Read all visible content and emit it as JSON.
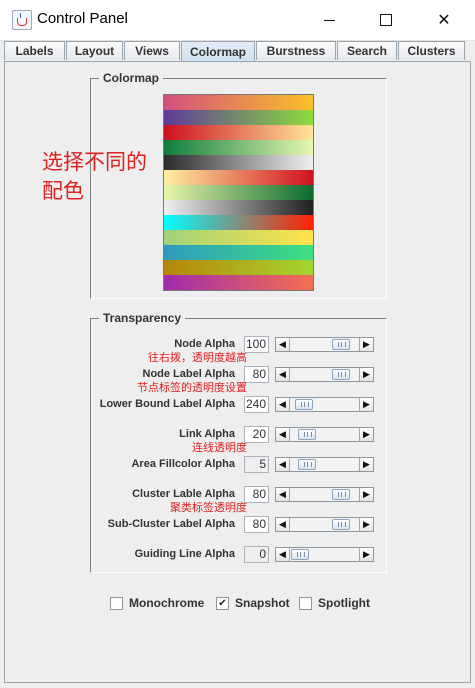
{
  "window": {
    "title": "Control Panel"
  },
  "tabs": [
    {
      "label": "Labels"
    },
    {
      "label": "Layout"
    },
    {
      "label": "Views"
    },
    {
      "label": "Colormap"
    },
    {
      "label": "Burstness"
    },
    {
      "label": "Search"
    },
    {
      "label": "Clusters"
    }
  ],
  "active_tab": "Colormap",
  "colormap": {
    "title": "Colormap",
    "note": "选择不同的配色",
    "swatches": [
      {
        "from": "#d2507e",
        "to": "#fbc02a"
      },
      {
        "from": "#5e3a9c",
        "to": "#8ddc3a"
      },
      {
        "from": "#cc1020",
        "to": "#ffe59a"
      },
      {
        "from": "#0e7d3e",
        "to": "#e6f7b0"
      },
      {
        "from": "#2b2b2b",
        "to": "#f0f0f0"
      },
      {
        "from": "#fff0a0",
        "to": "#d01020"
      },
      {
        "from": "#e8f5a8",
        "to": "#0d6b30"
      },
      {
        "from": "#f0f0f0",
        "to": "#202020"
      },
      {
        "from": "#00ffff",
        "to": "#ff2000"
      },
      {
        "from": "#9fd27a",
        "to": "#ffe34a"
      },
      {
        "from": "#2e9abf",
        "to": "#3ee07d"
      },
      {
        "from": "#b7860b",
        "to": "#a4d530"
      },
      {
        "from": "#a02bab",
        "to": "#f57050"
      }
    ]
  },
  "transparency": {
    "title": "Transparency",
    "rows": [
      {
        "label": "Node Alpha",
        "value": "100",
        "annotation": "往右拨，透明度越高",
        "level": 0.82
      },
      {
        "label": "Node Label Alpha",
        "value": "80",
        "annotation": "节点标签的透明度设置",
        "level": 0.82
      },
      {
        "label": "Lower Bound Label Alpha",
        "value": "240",
        "annotation": "",
        "level": 0.1
      },
      {
        "label": "Link Alpha",
        "value": "20",
        "annotation": "连线透明度",
        "level": 0.15
      },
      {
        "label": "Area Fillcolor Alpha",
        "value": "5",
        "annotation": "",
        "level": 0.15,
        "disabled": true
      },
      {
        "label": "Cluster Lable Alpha",
        "value": "80",
        "annotation": "聚类标签透明度",
        "level": 0.82
      },
      {
        "label": "Sub-Cluster Label Alpha",
        "value": "80",
        "annotation": "",
        "level": 0.82
      },
      {
        "label": "Guiding Line Alpha",
        "value": "0",
        "annotation": "",
        "level": 0.02,
        "disabled": true
      }
    ]
  },
  "options": [
    {
      "label": "Monochrome",
      "checked": false
    },
    {
      "label": "Snapshot",
      "checked": true
    },
    {
      "label": "Spotlight",
      "checked": false
    }
  ]
}
